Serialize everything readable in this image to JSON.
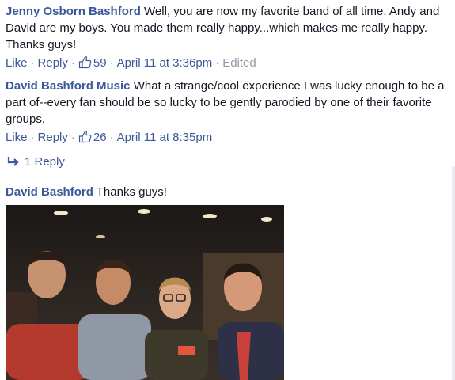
{
  "comments": [
    {
      "author": "Jenny Osborn Bashford",
      "text": "Well, you are now my favorite band of all time. Andy and David are my boys. You made them really happy...which makes me really happy. Thanks guys!",
      "like_label": "Like",
      "reply_label": "Reply",
      "likes": "59",
      "timestamp": "April 11 at 3:36pm",
      "edited": "Edited"
    },
    {
      "author": "David Bashford Music",
      "text": "What a strange/cool experience I was lucky enough to be a part of--every fan should be so lucky to be gently parodied by one of their favorite groups.",
      "like_label": "Like",
      "reply_label": "Reply",
      "likes": "26",
      "timestamp": "April 11 at 8:35pm",
      "replies_label": "1 Reply"
    },
    {
      "author": "David Bashford",
      "text": "Thanks guys!"
    }
  ],
  "icons": {
    "thumb": "thumbs-up-icon",
    "reply": "reply-arrow-icon"
  },
  "colors": {
    "link": "#3b5998",
    "meta": "#9197a3",
    "text": "#141823"
  }
}
